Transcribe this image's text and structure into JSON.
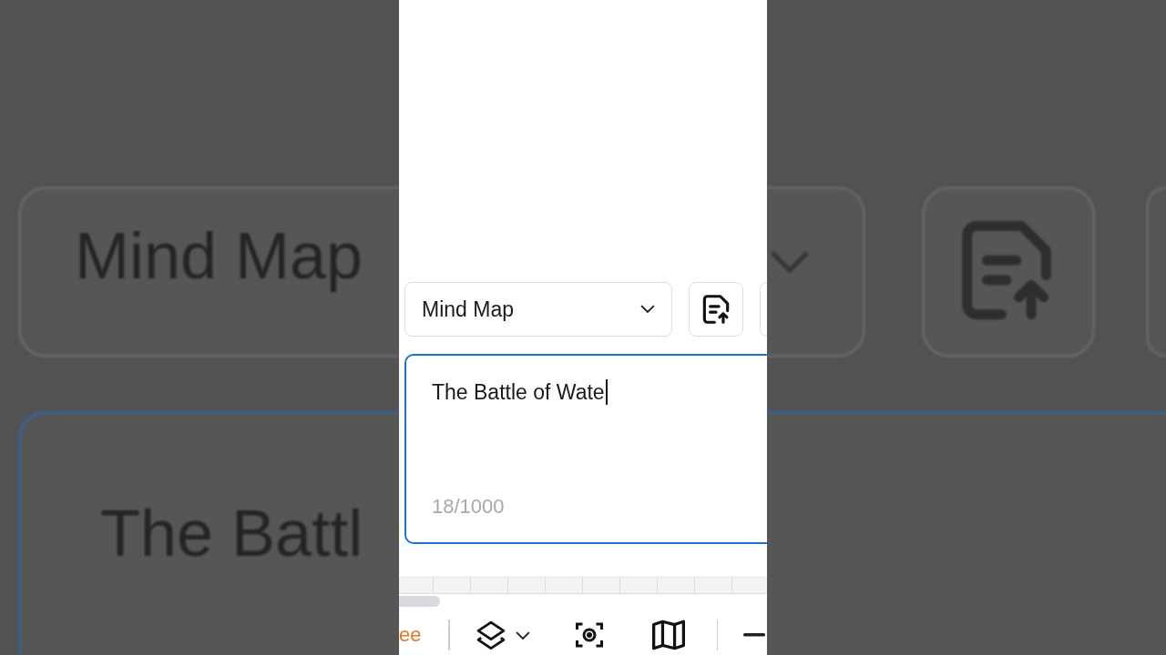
{
  "backdrop": {
    "mode_label": "Mind Map",
    "text_preview": "The Battl"
  },
  "mode_select": {
    "value": "Mind Map"
  },
  "prompt": {
    "value": "The Battle of Wate",
    "counter": "18/1000",
    "focused": true
  },
  "toolbar": {
    "left_label": "ee"
  }
}
